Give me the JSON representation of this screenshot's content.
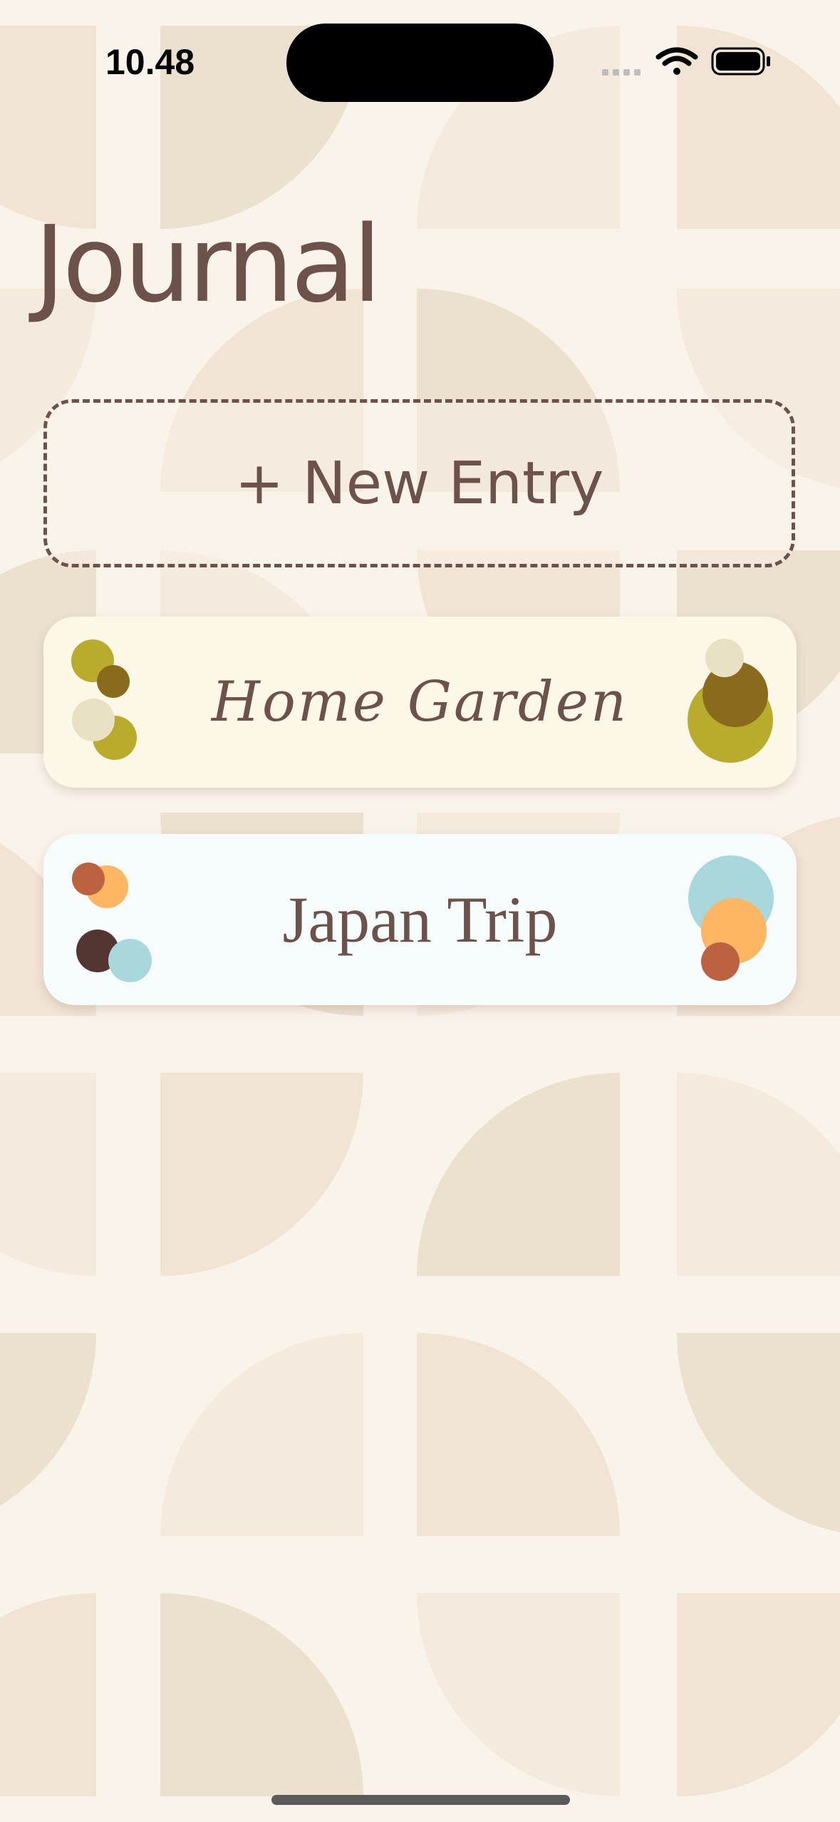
{
  "status_bar": {
    "time": "10.48",
    "icons": [
      "signal-dots-icon",
      "wifi-icon",
      "battery-icon"
    ]
  },
  "page": {
    "title": "Journal"
  },
  "new_entry": {
    "label": "+ New Entry"
  },
  "entries": [
    {
      "title": "Home Garden",
      "colors": [
        "#b9ab2b",
        "#8a6a1c",
        "#e8e1c3"
      ]
    },
    {
      "title": "Japan Trip",
      "colors": [
        "#a9d8dc",
        "#fdb662",
        "#bd6240",
        "#533531"
      ]
    }
  ],
  "theme": {
    "background": "#faf3ea",
    "text": "#6d524c",
    "pattern": [
      "#f1e4d4",
      "#ece0cf",
      "#f4eadd"
    ]
  }
}
